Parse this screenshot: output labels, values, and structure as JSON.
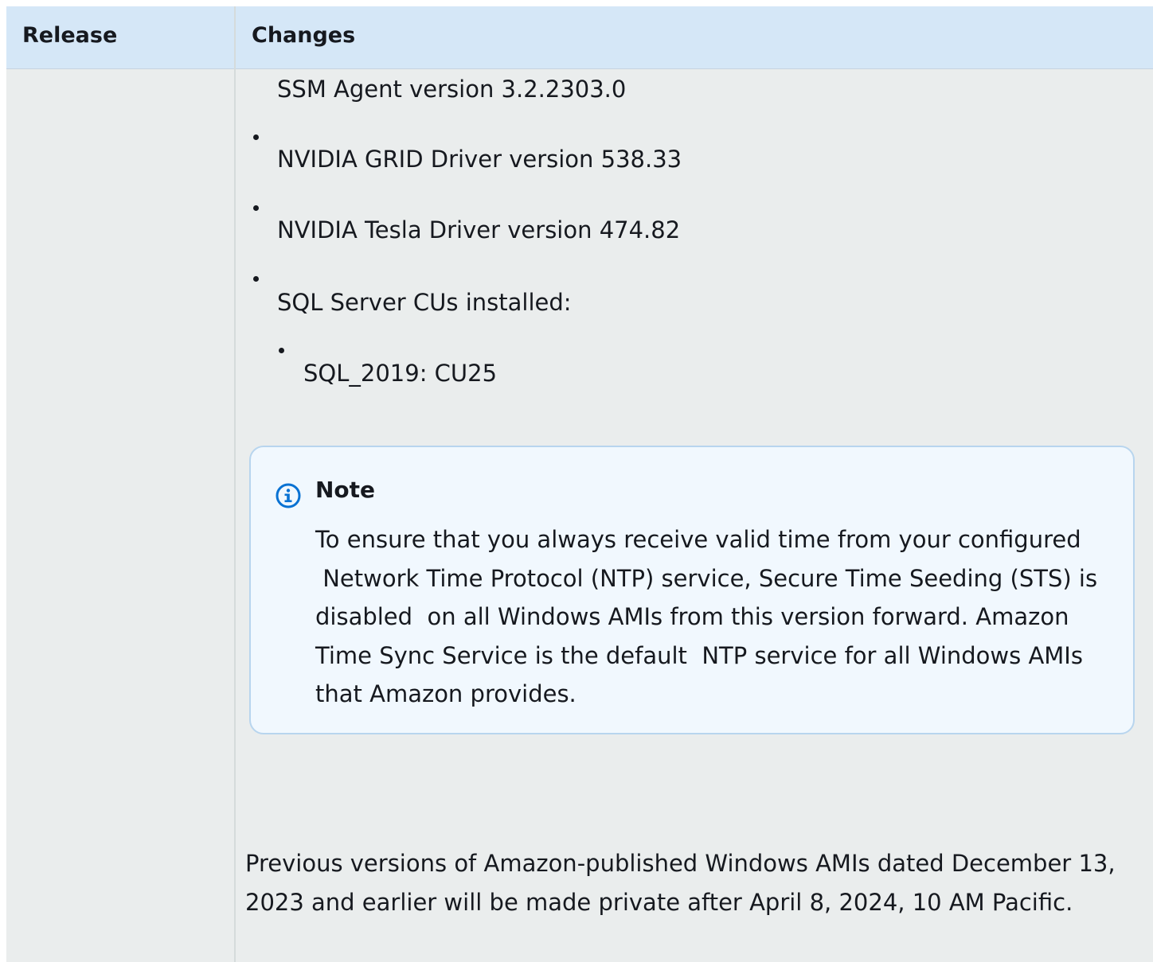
{
  "table": {
    "headers": {
      "release": "Release",
      "changes": "Changes"
    },
    "items": [
      "SSM Agent version 3.2.2303.0",
      "NVIDIA GRID Driver version 538.33",
      "NVIDIA Tesla Driver version 474.82",
      "SQL Server CUs installed:"
    ],
    "sub_items": [
      "SQL_2019: CU25"
    ],
    "note": {
      "title": "Note",
      "lines": [
        "To ensure that you always receive valid time from your configured",
        " Network Time Protocol (NTP) service, Secure Time Seeding (STS) is",
        "disabled  on all Windows AMIs from this version forward. Amazon",
        "Time Sync Service is the default  NTP service for all Windows AMIs",
        "that Amazon provides."
      ]
    },
    "footer": {
      "lines": [
        "Previous versions of Amazon-published Windows AMIs dated December 13,",
        "2023 and earlier will be made private after April 8, 2024, 10 AM Pacific."
      ]
    }
  },
  "colors": {
    "header_bg": "#d5e7f7",
    "body_bg": "#eaeded",
    "note_bg": "#f1f8fe",
    "note_border": "#b8d5ee",
    "info_icon": "#0972d3"
  },
  "icons": {
    "note": "info-icon"
  }
}
